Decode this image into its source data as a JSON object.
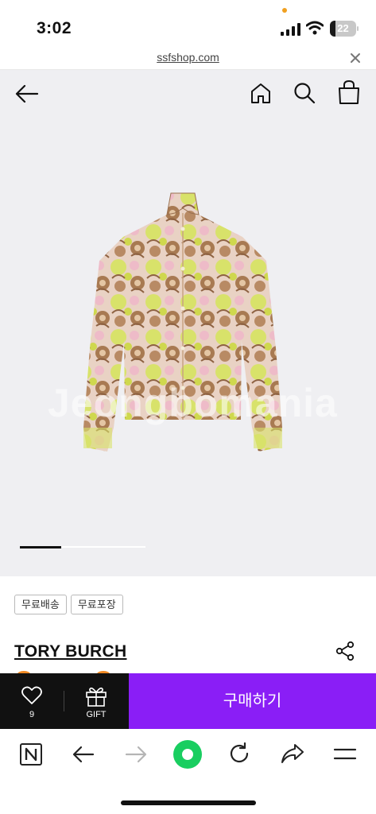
{
  "status_bar": {
    "time": "3:02",
    "battery_level": "22",
    "battery_fraction": 0.22
  },
  "browser": {
    "url": "ssfshop.com",
    "close_icon": "close-icon"
  },
  "header": {
    "back_icon": "arrow-left-icon",
    "home_icon": "home-icon",
    "search_icon": "search-icon",
    "bag_icon": "shopping-bag-icon"
  },
  "gallery": {
    "image_description_icon": "product-image",
    "watermark": "Jeongbomania",
    "carousel_progress": 0.33
  },
  "product": {
    "badges": [
      "무료배송",
      "무료포장"
    ],
    "brand": "TORY BURCH",
    "share_icon": "share-icon"
  },
  "action_bar": {
    "like_icon": "heart-icon",
    "like_count": "9",
    "gift_icon": "gift-icon",
    "gift_label": "GIFT",
    "buy_label": "구매하기"
  },
  "browser_toolbar": {
    "items": [
      "naver-n-icon",
      "arrow-left-icon",
      "arrow-right-icon",
      "green-dot-home-icon",
      "reload-icon",
      "share-arrow-icon",
      "menu-icon"
    ]
  },
  "colors": {
    "accent": "#8a1ef6",
    "header_bg": "#efeff2",
    "action_dark": "#111111",
    "naver_green": "#19ce60"
  }
}
